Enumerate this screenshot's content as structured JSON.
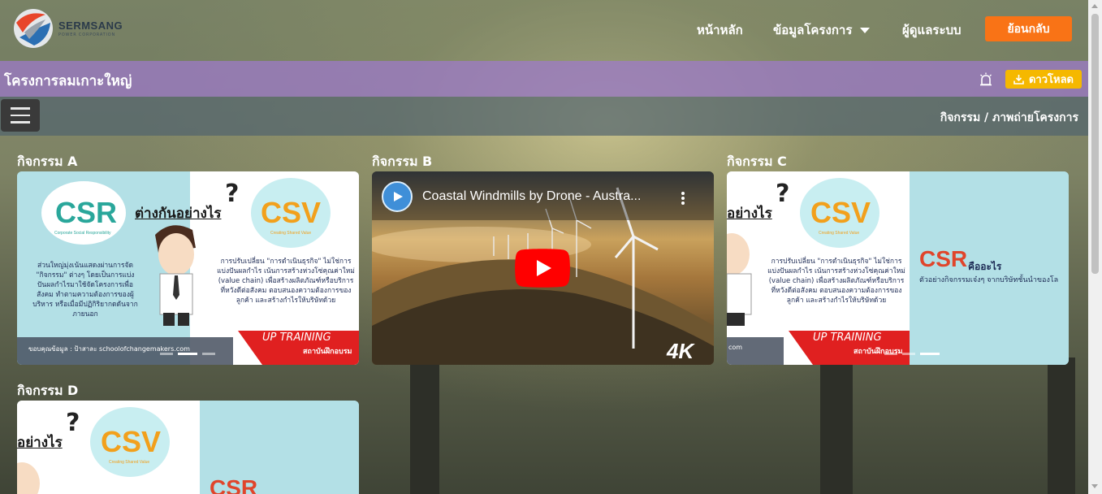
{
  "brand": {
    "name": "SERMSANG",
    "tagline": "POWER CORPORATION"
  },
  "nav": {
    "home": "หน้าหลัก",
    "project_info": "ข้อมูลโครงการ",
    "admin": "ผู้ดูแลระบบ",
    "back": "ย้อนกลับ"
  },
  "project": {
    "title": "โครงการลมเกาะใหญ่",
    "download_label": "ดาวโหลด"
  },
  "breadcrumb": "กิจกรรม / ภาพถ่ายโครงการ",
  "activities": [
    {
      "label": "กิจกรรม A"
    },
    {
      "label": "กิจกรรม B"
    },
    {
      "label": "กิจกรรม C"
    },
    {
      "label": "กิจกรรม D"
    }
  ],
  "slide": {
    "csr": "CSR",
    "csr_sub": "Corporate Social Responsibility",
    "csv": "CSV",
    "csv_sub": "Creating Shared Value",
    "diff": "ต่างกันอย่างไร",
    "diff_partial": "อย่างไร",
    "left_text": "ส่วนใหญ่มุ่งเน้นแสดงผ่านการจัด \"กิจกรรม\" ต่างๆ โดยเป็นการแบ่งปันผลกำไรมาใช้จัดโครงการเพื่อสังคม ทำตามความต้องการของผู้บริหาร หรือเมื่อมีปฏิกิริยากดดันจากภายนอก",
    "right_text": "การปรับเปลี่ยน \"การดำเนินธุรกิจ\" ไม่ใช่การแบ่งปันผลกำไร เน้นการสร้างห่วงโซ่คุณค่าใหม่ (value chain) เพื่อสร้างผลิตภัณฑ์หรือบริการที่หวังดีต่อสังคม ตอบสนองความต้องการของลูกค้า และสร้างกำไรให้บริษัทด้วย",
    "banner": "UP TRAINING",
    "banner_sub": "สถาบันฝึกอบรม",
    "credit": "ขอบคุณข้อมูล : ป้าสาละ schoolofchangemakers.com",
    "credit_partial": "com",
    "csr_question_suffix": "คืออะไร",
    "csr_example": "ตัวอย่างกิจกรรมเจ๋งๆ จากบริษัทชั้นนำของโล"
  },
  "video": {
    "title": "Coastal Windmills by Drone - Austra...",
    "badge": "4K"
  },
  "colors": {
    "accent_orange": "#f97316",
    "download_yellow": "#f5b800",
    "title_purple": "#9678be",
    "yt_red": "#ff0000"
  }
}
